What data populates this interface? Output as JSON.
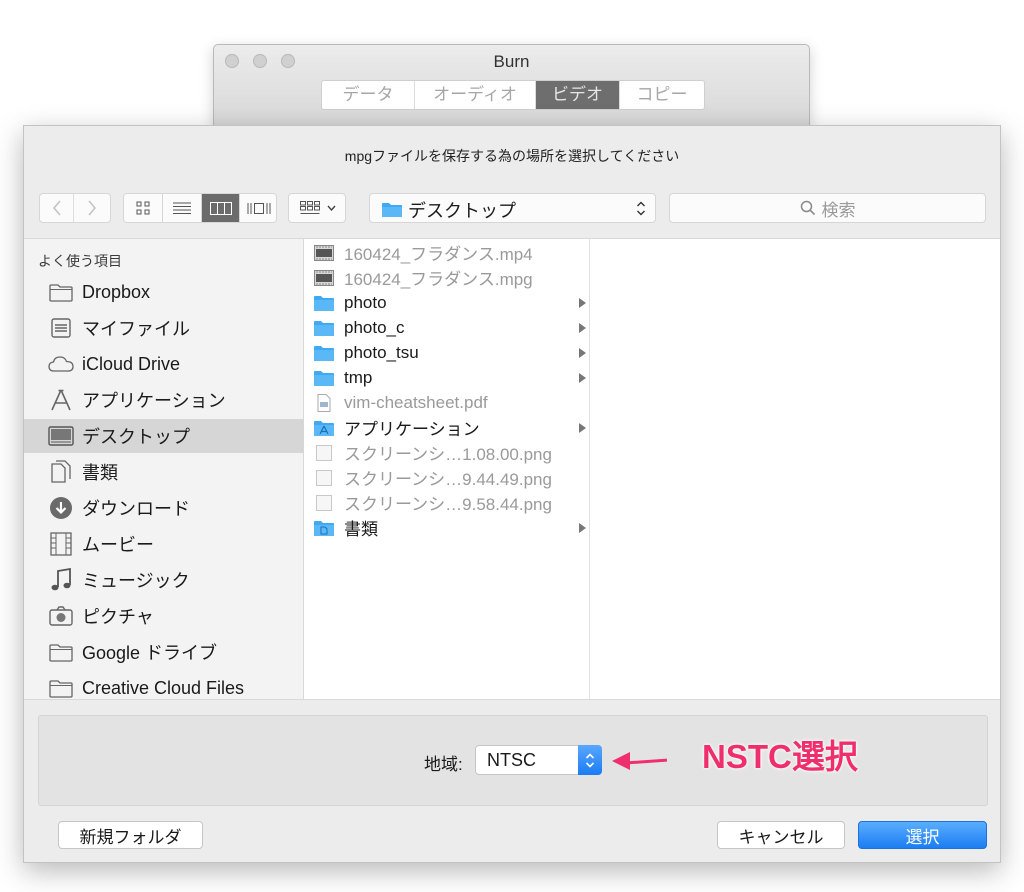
{
  "window": {
    "title": "Burn",
    "tabs": [
      {
        "label": "データ"
      },
      {
        "label": "オーディオ"
      },
      {
        "label": "ビデオ",
        "active": true
      },
      {
        "label": "コピー"
      }
    ]
  },
  "dialog": {
    "prompt": "mpgファイルを保存する為の場所を選択してください",
    "toolbar": {
      "location": "デスクトップ",
      "search_placeholder": "検索"
    },
    "sidebar": {
      "header": "よく使う項目",
      "items": [
        {
          "label": "Dropbox",
          "icon": "folder-icon"
        },
        {
          "label": "マイファイル",
          "icon": "all-files-icon"
        },
        {
          "label": "iCloud Drive",
          "icon": "cloud-icon"
        },
        {
          "label": "アプリケーション",
          "icon": "applications-icon"
        },
        {
          "label": "デスクトップ",
          "icon": "desktop-icon",
          "selected": true
        },
        {
          "label": "書類",
          "icon": "documents-icon"
        },
        {
          "label": "ダウンロード",
          "icon": "download-icon"
        },
        {
          "label": "ムービー",
          "icon": "movie-icon"
        },
        {
          "label": "ミュージック",
          "icon": "music-icon"
        },
        {
          "label": "ピクチャ",
          "icon": "camera-icon"
        },
        {
          "label": "Google ドライブ",
          "icon": "folder-icon"
        },
        {
          "label": "Creative Cloud Files",
          "icon": "folder-icon"
        }
      ]
    },
    "files": [
      {
        "name": "160424_フラダンス.mp4",
        "kind": "video",
        "dim": true
      },
      {
        "name": "160424_フラダンス.mpg",
        "kind": "video",
        "dim": true
      },
      {
        "name": "photo",
        "kind": "folder",
        "dim": false
      },
      {
        "name": "photo_c",
        "kind": "folder",
        "dim": false
      },
      {
        "name": "photo_tsu",
        "kind": "folder",
        "dim": false
      },
      {
        "name": "tmp",
        "kind": "folder",
        "dim": false
      },
      {
        "name": "vim-cheatsheet.pdf",
        "kind": "pdf",
        "dim": true
      },
      {
        "name": "アプリケーション",
        "kind": "folder-special",
        "dim": false
      },
      {
        "name": "スクリーンシ…1.08.00.png",
        "kind": "image",
        "dim": true
      },
      {
        "name": "スクリーンシ…9.44.49.png",
        "kind": "image",
        "dim": true
      },
      {
        "name": "スクリーンシ…9.58.44.png",
        "kind": "image",
        "dim": true
      },
      {
        "name": "書類",
        "kind": "folder-special",
        "dim": false
      }
    ],
    "accessory": {
      "region_label": "地域:",
      "region_value": "NTSC",
      "annotation": "NSTC選択"
    },
    "buttons": {
      "new_folder": "新規フォルダ",
      "cancel": "キャンセル",
      "choose": "選択"
    },
    "colors": {
      "accent": "#1b7df3",
      "annotation": "#ef2f6d",
      "folder": "#3fa9f5"
    }
  }
}
